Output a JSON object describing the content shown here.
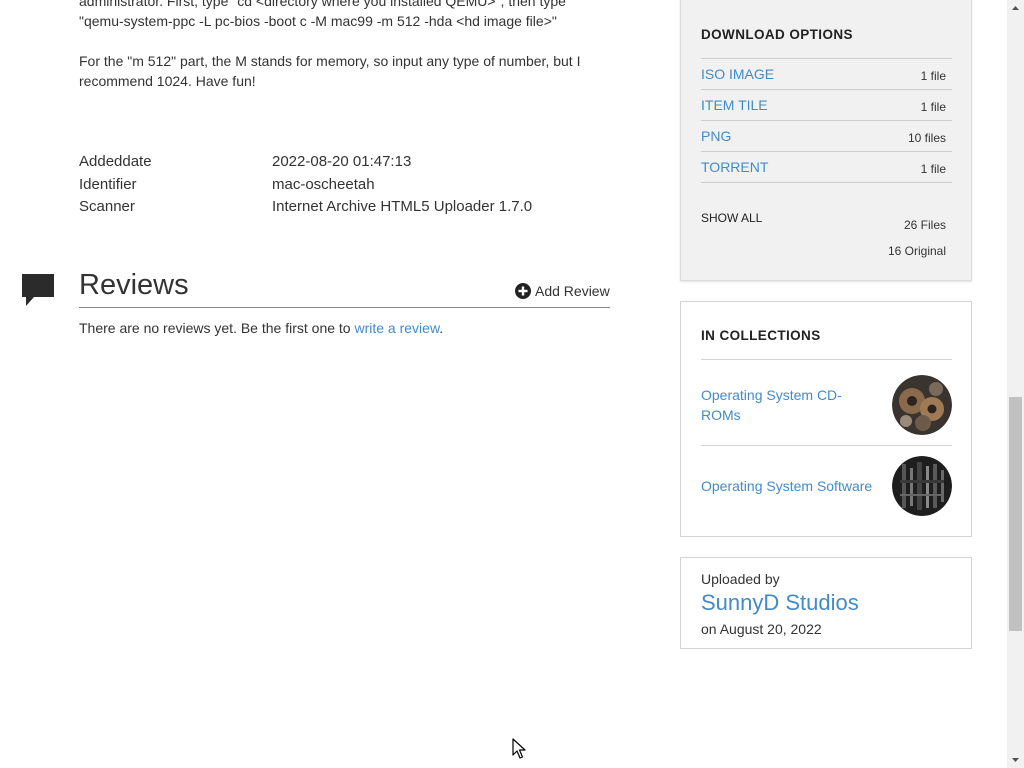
{
  "description": {
    "line1": "administrator. First, type \"cd <directory where you installed QEMU>\", then type",
    "line2": "\"qemu-system-ppc -L pc-bios -boot c -M mac99 -m 512 -hda <hd image file>\"",
    "mem_line1": "For the \"m 512\" part, the M stands for memory, so input any type of number, but I",
    "mem_line2": "recommend 1024. Have fun!"
  },
  "metadata": [
    {
      "key": "Addeddate",
      "value": "2022-08-20 01:47:13"
    },
    {
      "key": "Identifier",
      "value": "mac-oscheetah"
    },
    {
      "key": "Scanner",
      "value": "Internet Archive HTML5 Uploader 1.7.0"
    }
  ],
  "reviews": {
    "icon": "speech-bubble-icon",
    "title": "Reviews",
    "add_label": "Add Review",
    "empty_text": "There are no reviews yet. Be the first one to",
    "empty_link": "write a review",
    "empty_end": "."
  },
  "download_options": {
    "heading": "DOWNLOAD OPTIONS",
    "items": [
      {
        "name": "ISO IMAGE",
        "count": "1 file"
      },
      {
        "name": "ITEM TILE",
        "count": "1 file"
      },
      {
        "name": "PNG",
        "count": "10 files"
      },
      {
        "name": "TORRENT",
        "count": "1 file"
      }
    ],
    "show_all": "SHOW ALL",
    "total_files": "26 Files",
    "original_files": "16 Original"
  },
  "collections": {
    "heading": "IN COLLECTIONS",
    "items": [
      {
        "name": "Operating System CD-ROMs",
        "thumb": "gears-thumbnail"
      },
      {
        "name": "Operating System Software",
        "thumb": "circuit-thumbnail"
      }
    ]
  },
  "uploader": {
    "label": "Uploaded by",
    "name": "SunnyD Studios",
    "date": "on August 20, 2022"
  },
  "colors": {
    "link": "#428bca",
    "text": "#333333",
    "panel_bg": "#f1f1f1"
  }
}
